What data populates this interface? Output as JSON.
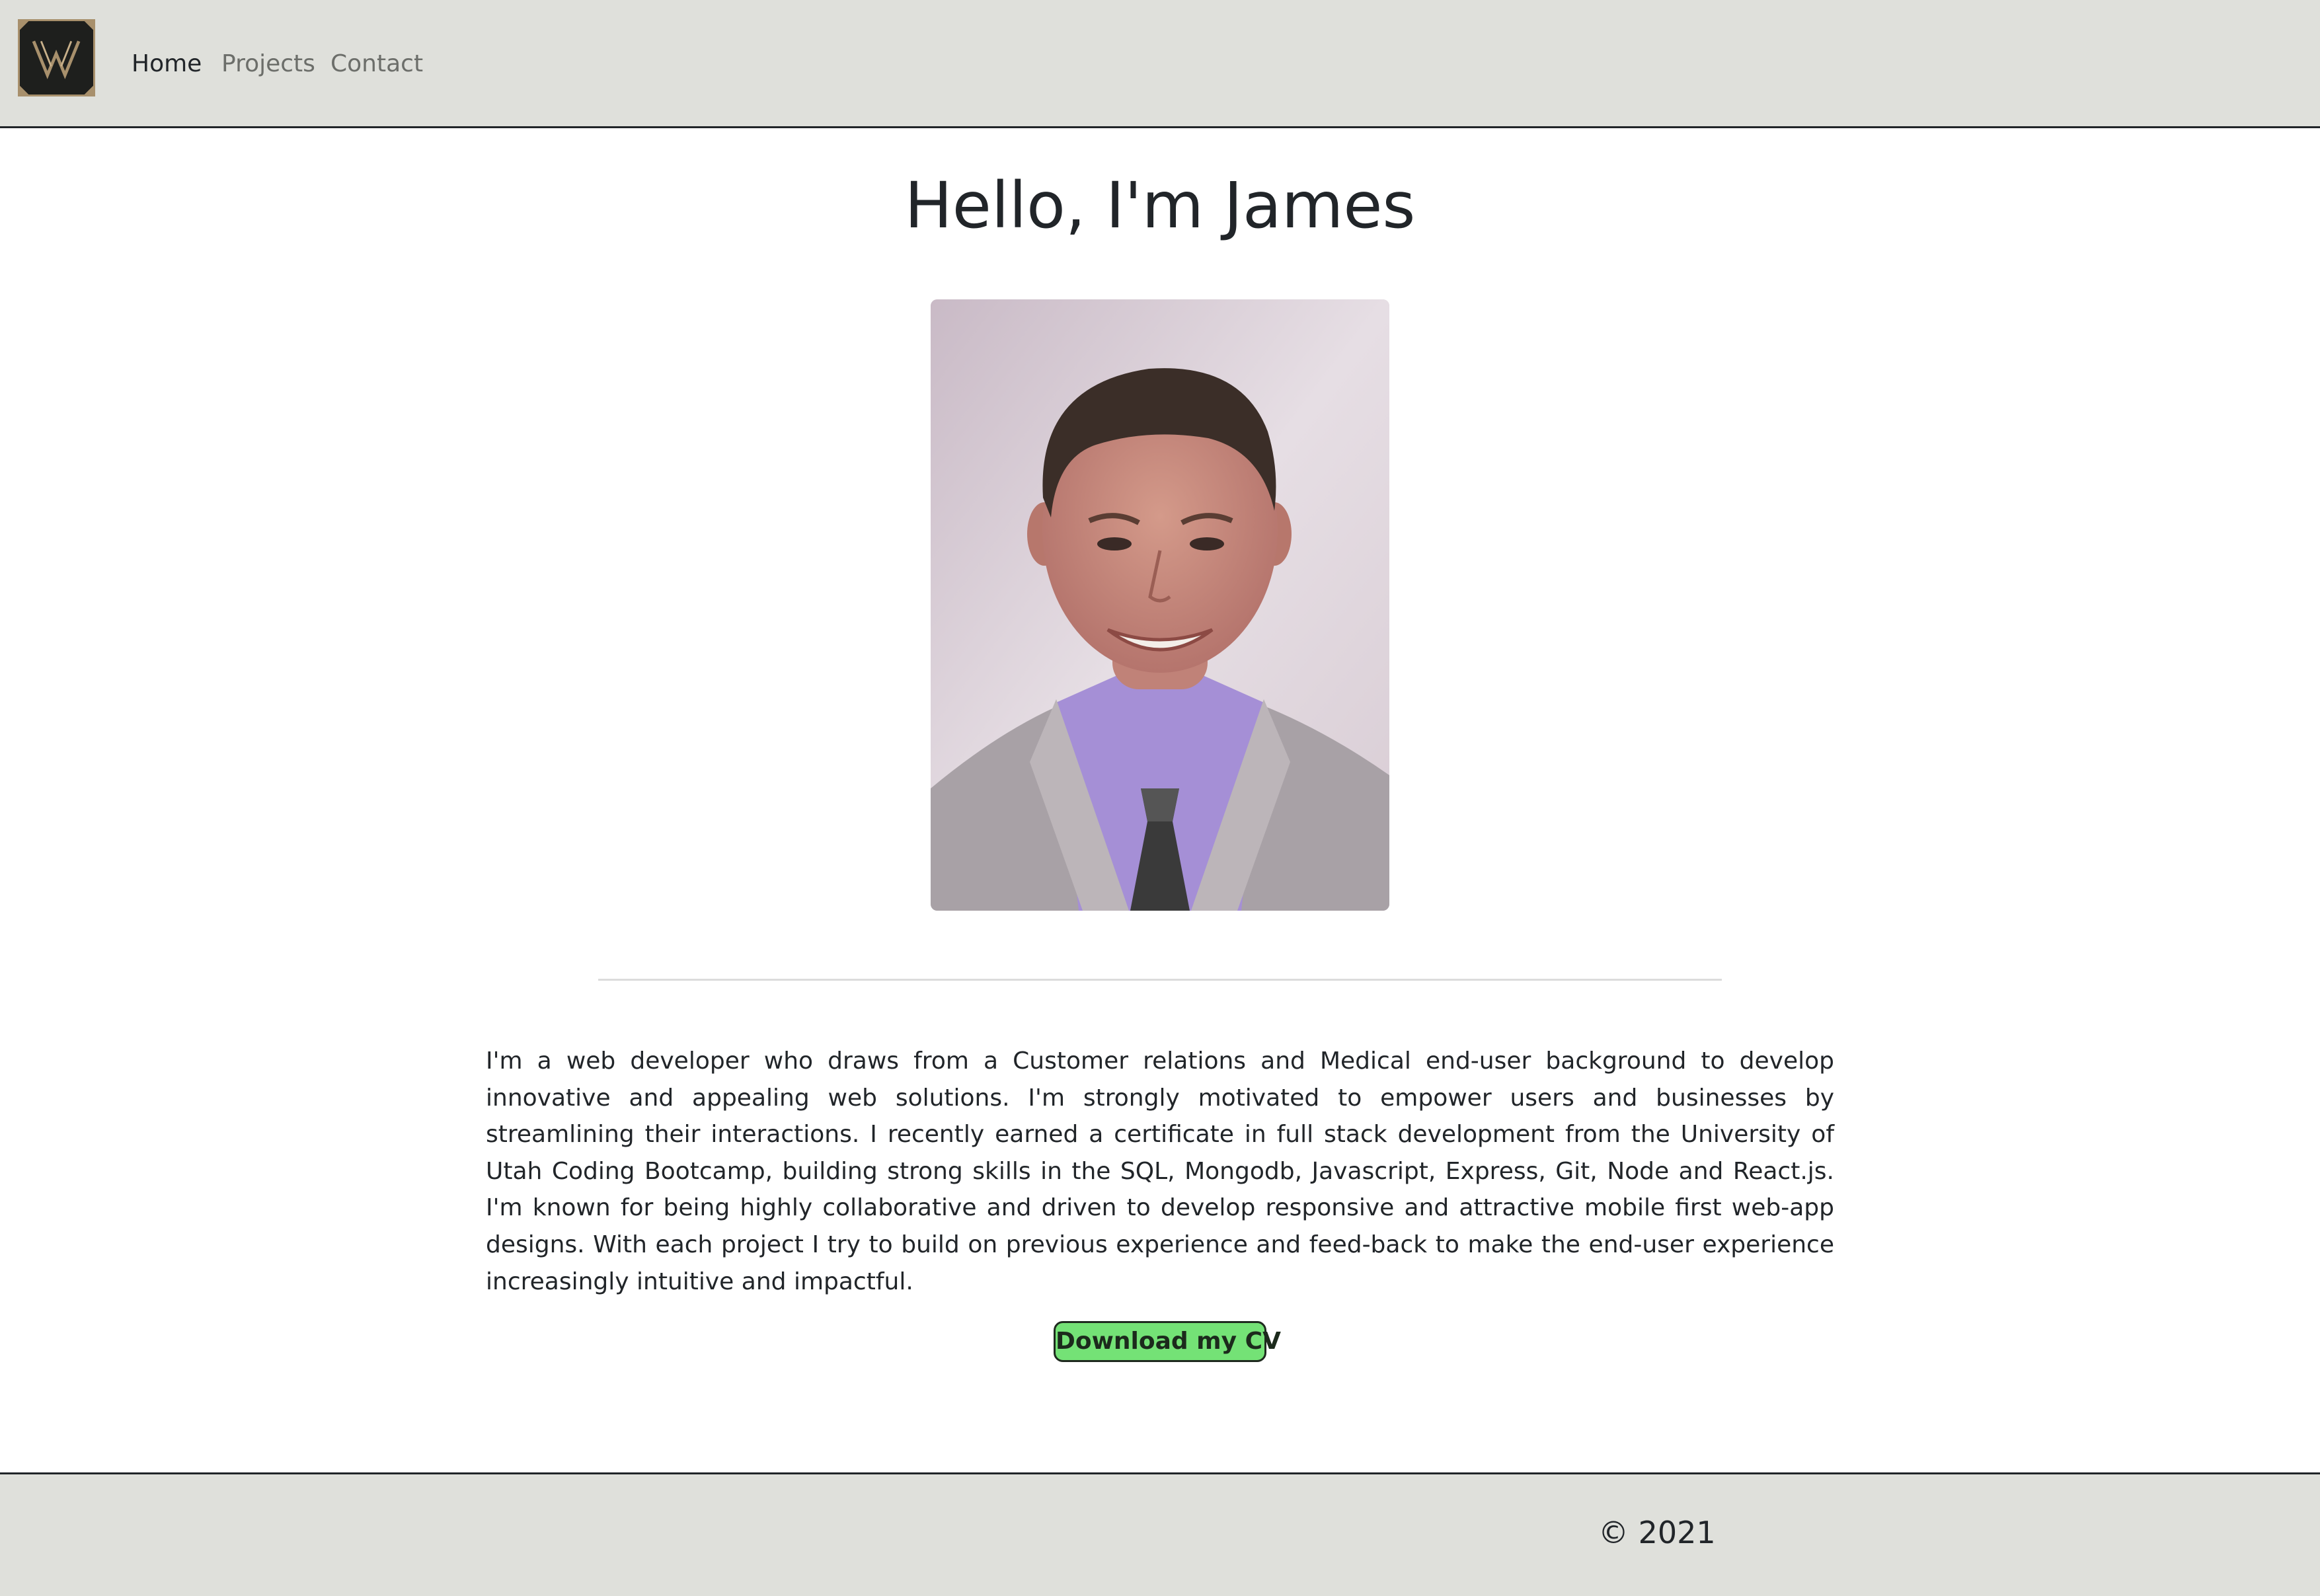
{
  "nav": {
    "logo_icon": "w-monogram-logo-icon",
    "items": [
      {
        "label": "Home",
        "active": true
      },
      {
        "label": "Projects",
        "active": false
      },
      {
        "label": "Contact",
        "active": false
      }
    ]
  },
  "hero": {
    "title": "Hello, I'm James",
    "portrait_icon": "profile-photo"
  },
  "bio": {
    "text": "I'm a web developer who draws from a Customer relations and Medical end-user background to develop innovative and appealing web solutions. I'm strongly motivated to empower users and businesses by streamlining their interactions. I recently earned a certificate in full stack development from the University of Utah Coding Bootcamp, building strong skills in the SQL, Mongodb, Javascript, Express, Git, Node and React.js. I'm known for being highly collaborative and driven to develop responsive and attractive mobile first web-app designs. With each project I try to build on previous experience and feed-back to make the end-user experience increasingly intuitive and impactful."
  },
  "cta": {
    "download_cv_label": "Download my CV"
  },
  "footer": {
    "copyright": "© 2021"
  },
  "colors": {
    "navbar_bg": "#dfe0db",
    "button_bg": "#74e276",
    "logo_bg": "#1e1f1d",
    "logo_gold": "#a8906c"
  }
}
